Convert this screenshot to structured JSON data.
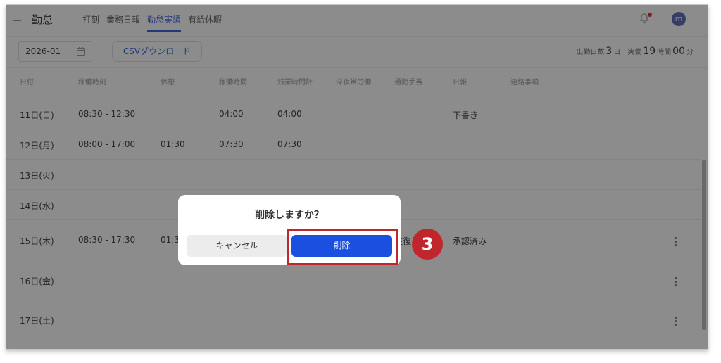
{
  "header": {
    "app_title": "勤怠",
    "tabs": [
      {
        "label": "打刻",
        "active": false
      },
      {
        "label": "業務日報",
        "active": false
      },
      {
        "label": "勤怠実績",
        "active": true
      },
      {
        "label": "有給休暇",
        "active": false
      }
    ],
    "avatar_initial": "m",
    "icons": [
      "menu-icon",
      "bell-icon"
    ]
  },
  "toolbar": {
    "month_value": "2026-01",
    "csv_button_label": "CSVダウンロード",
    "summary": {
      "workdays_label": "出勤日数",
      "workdays_value": "3",
      "workdays_unit": "日",
      "actual_label": "実働",
      "actual_hours": "19",
      "hours_unit": "時間",
      "actual_minutes": "00",
      "minutes_unit": "分"
    }
  },
  "table": {
    "columns": [
      "日付",
      "稼働時刻",
      "休憩",
      "稼働時間",
      "残業時間計",
      "深夜帯労働",
      "通勤手当",
      "日報",
      "連絡事項"
    ],
    "rows": [
      {
        "date": "11日(日)",
        "time": "08:30 - 12:30",
        "break": "",
        "work": "04:00",
        "overtime": "04:00",
        "report": "下書き",
        "extra": "",
        "menu": false
      },
      {
        "date": "12日(月)",
        "time": "08:00 - 17:00",
        "break": "01:30",
        "work": "07:30",
        "overtime": "07:30",
        "report": "",
        "extra": "",
        "menu": false
      },
      {
        "date": "13日(火)",
        "time": "",
        "break": "",
        "work": "",
        "overtime": "",
        "report": "",
        "extra": "",
        "menu": false
      },
      {
        "date": "14日(水)",
        "time": "",
        "break": "",
        "work": "",
        "overtime": "",
        "report": "",
        "extra": "",
        "menu": false
      },
      {
        "date": "15日(木)",
        "time": "08:30 - 17:30",
        "break": "01:3",
        "work": "",
        "overtime": "",
        "report": "承認済み",
        "extra": "往復",
        "menu": true
      },
      {
        "date": "16日(金)",
        "time": "",
        "break": "",
        "work": "",
        "overtime": "",
        "report": "",
        "extra": "",
        "menu": true
      },
      {
        "date": "17日(土)",
        "time": "",
        "break": "",
        "work": "",
        "overtime": "",
        "report": "",
        "extra": "",
        "menu": true
      }
    ]
  },
  "dialog": {
    "title": "削除しますか？",
    "cancel_label": "キャンセル",
    "delete_label": "削除"
  },
  "annotation": {
    "step_number": "3",
    "color": "#c0272d"
  },
  "colors": {
    "accent": "#3f6ae0",
    "delete_button": "#1a4fe0",
    "overlay": "rgba(0,0,0,0.45)"
  }
}
